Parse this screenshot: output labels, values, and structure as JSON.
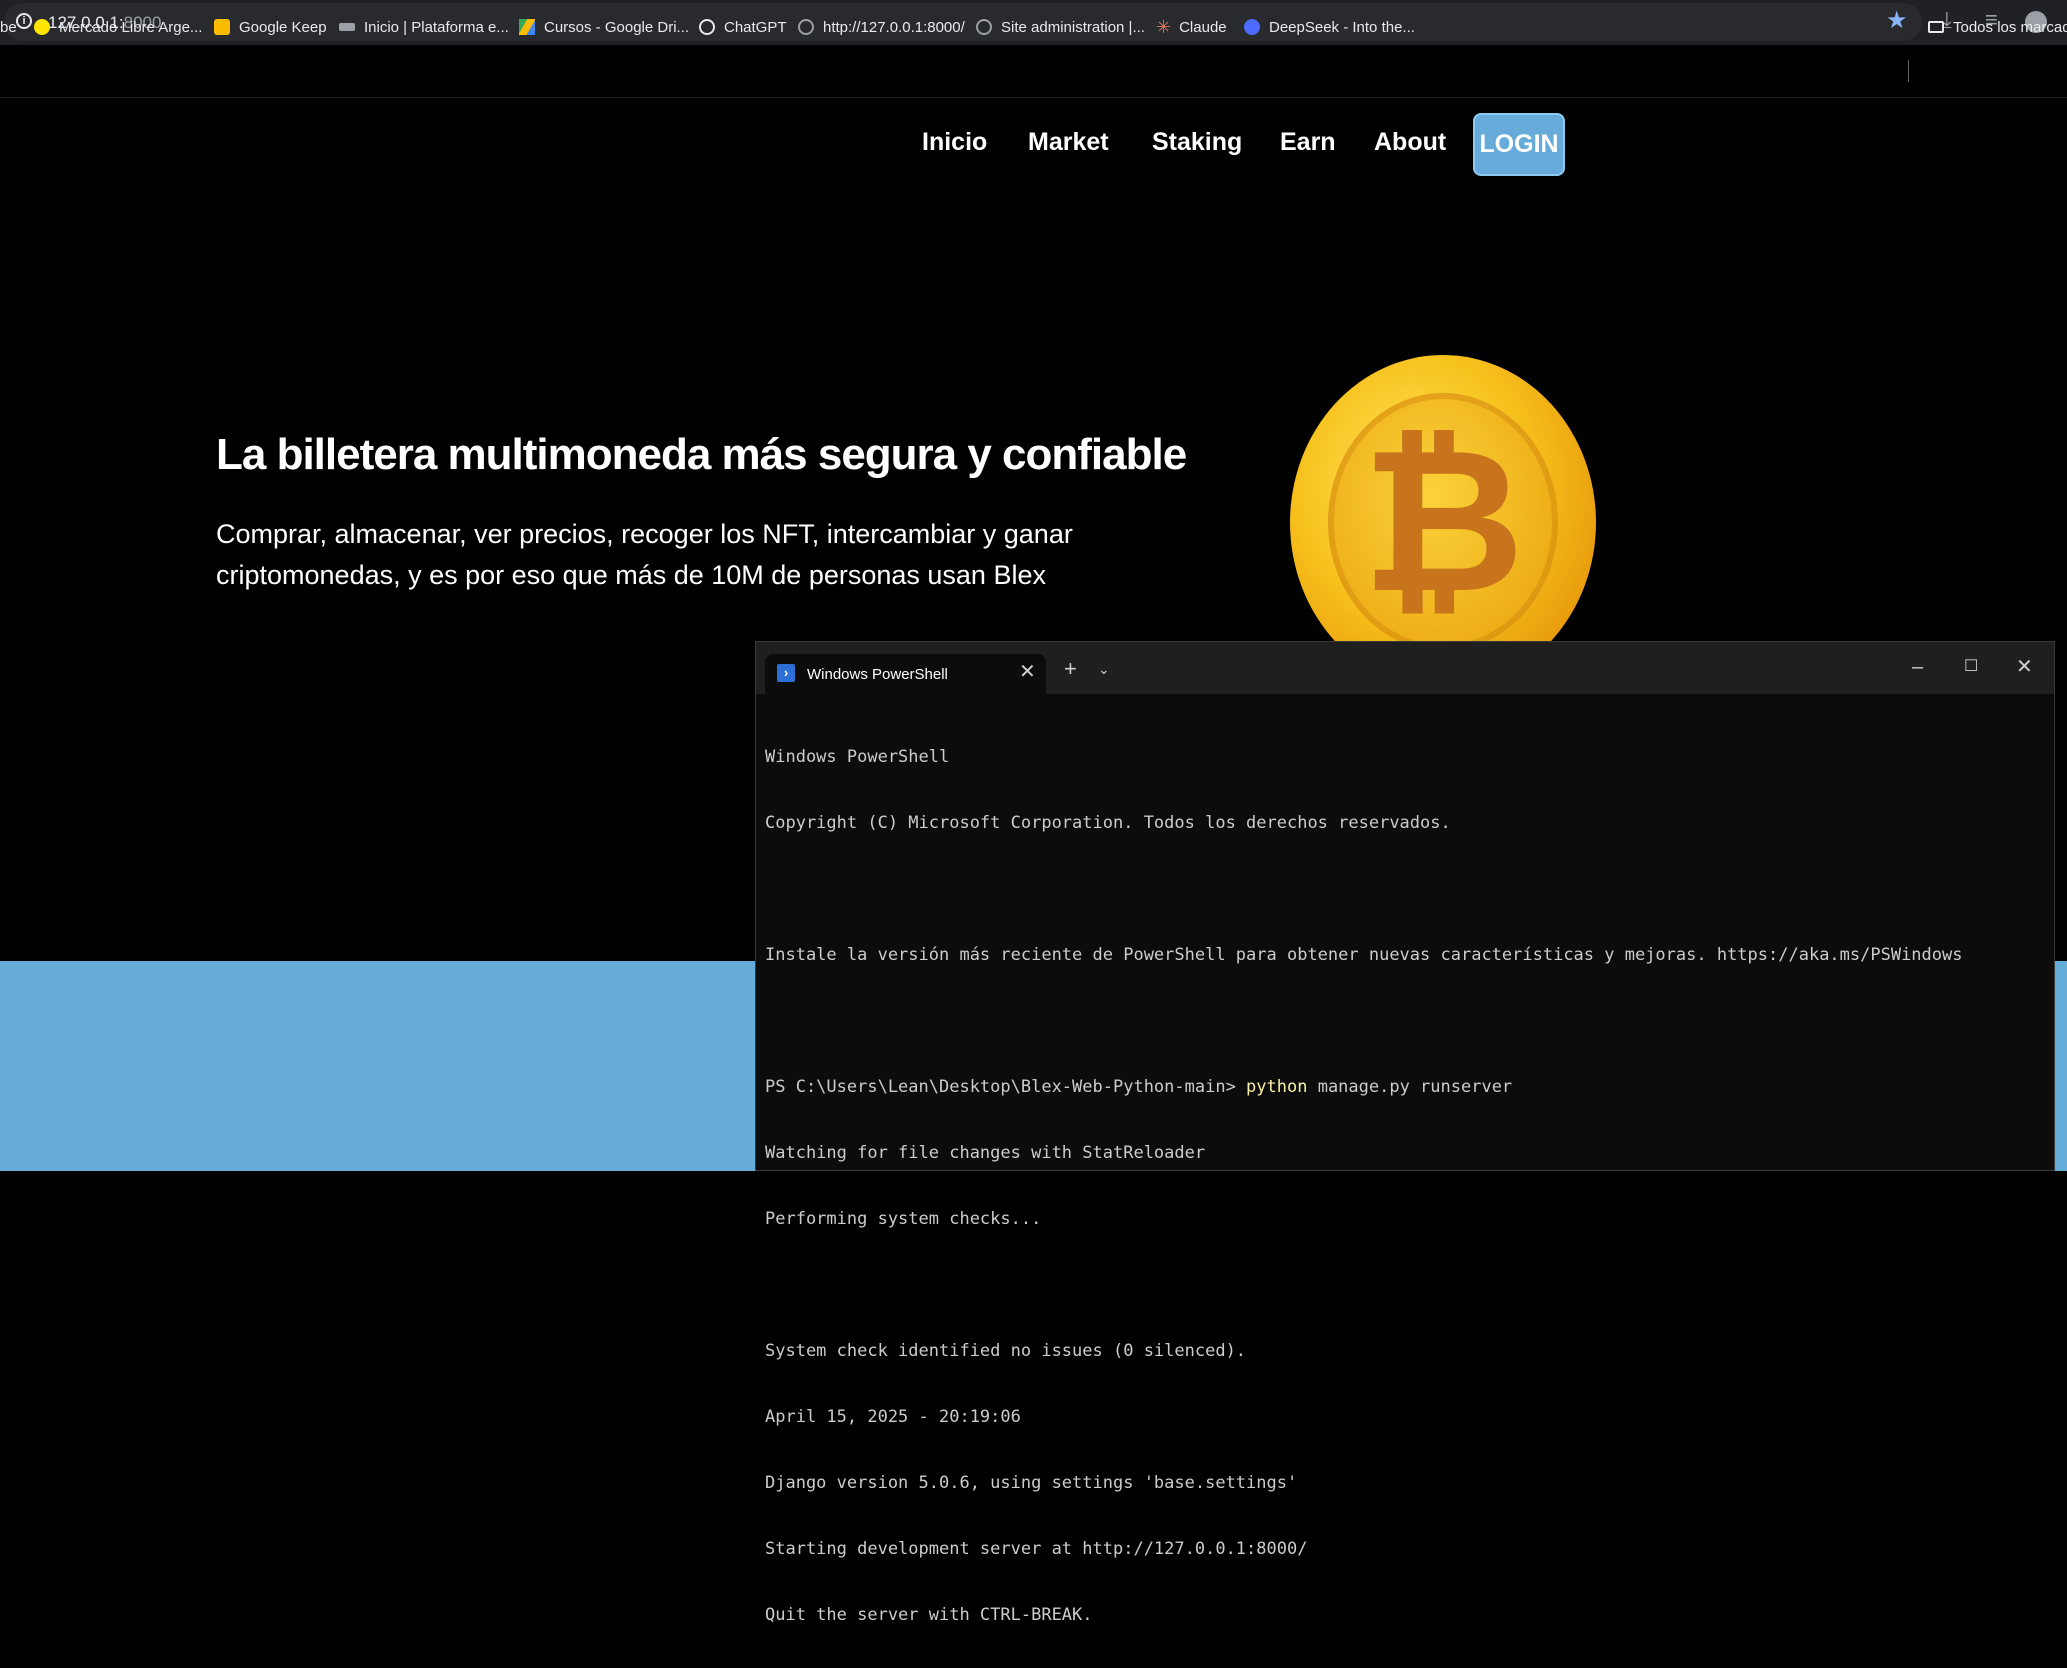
{
  "browser": {
    "url_host": "127.0.0.1:",
    "url_port": "8000",
    "bookmarks": [
      {
        "label": "be",
        "color": ""
      },
      {
        "label": "Mercado Libre Arge...",
        "color": "#ffe600"
      },
      {
        "label": "Google Keep",
        "color": "#fbbc04"
      },
      {
        "label": "Inicio | Plataforma e...",
        "color": "#9aa0a6"
      },
      {
        "label": "Cursos - Google Dri...",
        "color": "#34a853"
      },
      {
        "label": "ChatGPT",
        "color": "#e8eaed"
      },
      {
        "label": "http://127.0.0.1:8000/",
        "color": "#9aa0a6"
      },
      {
        "label": "Site administration |...",
        "color": "#9aa0a6"
      },
      {
        "label": "Claude",
        "color": "#d97757"
      },
      {
        "label": "DeepSeek - Into the...",
        "color": "#4d6bfe"
      },
      {
        "label": "Todos los marcado",
        "color": ""
      }
    ]
  },
  "site": {
    "nav": [
      "Inicio",
      "Market",
      "Staking",
      "Earn",
      "About"
    ],
    "login_label": "LOGIN",
    "hero_title": "La billetera multimoneda más segura y confiable",
    "hero_subtitle": "Comprar, almacenar, ver precios, recoger los NFT, intercambiar y ganar criptomonedas, y es por eso que más de 10M de personas usan Blex",
    "coin_symbol": "₿"
  },
  "terminal": {
    "tab_title": "Windows PowerShell",
    "lines": {
      "l1": "Windows PowerShell",
      "l2": "Copyright (C) Microsoft Corporation. Todos los derechos reservados.",
      "l3": "Instale la versión más reciente de PowerShell para obtener nuevas características y mejoras. https://aka.ms/PSWindows",
      "prompt": "PS C:\\Users\\Lean\\Desktop\\Blex-Web-Python-main> ",
      "cmd": "python",
      "args": " manage.py runserver",
      "l5": "Watching for file changes with StatReloader",
      "l6": "Performing system checks...",
      "l7": "System check identified no issues (0 silenced).",
      "l8": "April 15, 2025 - 20:19:06",
      "l9": "Django version 5.0.6, using settings 'base.settings'",
      "l10": "Starting development server at http://127.0.0.1:8000/",
      "l11": "Quit the server with CTRL-BREAK."
    }
  },
  "colors": {
    "accent_blue": "#66abd9",
    "terminal_command": "#f9f1a5"
  }
}
